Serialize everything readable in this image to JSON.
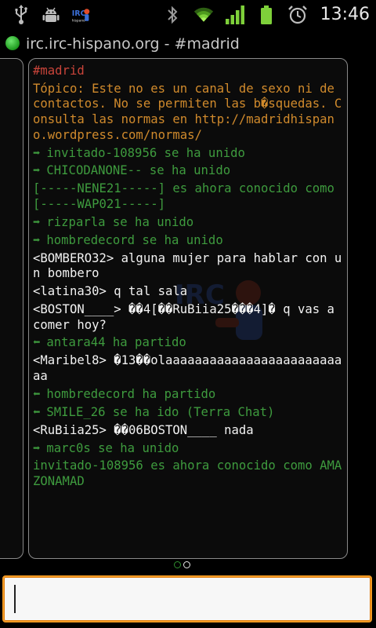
{
  "status_bar": {
    "time": "13:46",
    "icons": [
      "usb-icon",
      "android-debug-icon",
      "irc-hispano-app-icon",
      "bluetooth-icon",
      "wifi-icon",
      "signal-icon",
      "battery-icon",
      "alarm-icon"
    ],
    "app_icon_text": "IRC"
  },
  "title_bar": {
    "title": "irc.irc-hispano.org - #madrid",
    "status_color": "#2fb62f"
  },
  "watermark_text": "IRC",
  "colors": {
    "channel": "#c9443a",
    "topic": "#d08a2c",
    "event": "#3e9b3e",
    "message": "#f2f2f2",
    "input_border": "#f29a24"
  },
  "chat": {
    "messages": [
      {
        "type": "channel",
        "text": "#madrid"
      },
      {
        "type": "topic",
        "text": "Tópico: Este no es un canal de sexo ni de contactos. No se permiten las b�squedas. Consulta las normas en http://madridhispano.wordpress.com/normas/"
      },
      {
        "type": "join",
        "arrow": "➡",
        "text": "invitado-108956 se ha unido"
      },
      {
        "type": "join",
        "arrow": "➡",
        "text": "CHICODANONE-- se ha unido"
      },
      {
        "type": "event",
        "text": "[-----NENE21-----] es ahora conocido como [-----WAP021-----]"
      },
      {
        "type": "join",
        "arrow": "➡",
        "text": "rizparla se ha unido"
      },
      {
        "type": "join",
        "arrow": "➡",
        "text": "hombredecord se ha unido"
      },
      {
        "type": "message",
        "text": "<BOMBERO32> alguna mujer para hablar con un bombero"
      },
      {
        "type": "message",
        "text": "<latina30> q tal sala"
      },
      {
        "type": "message",
        "text": "<BOSTON____> ��4[��RuBiia25���4]� q vas a comer hoy?"
      },
      {
        "type": "part",
        "arrow": "⬅",
        "text": "antara44 ha partido"
      },
      {
        "type": "message",
        "text": "<Maribel8> �13��olaaaaaaaaaaaaaaaaaaaaaaaaaa"
      },
      {
        "type": "part",
        "arrow": "⬅",
        "text": "hombredecord ha partido"
      },
      {
        "type": "part",
        "arrow": "⬅",
        "text": "SMILE_26 se ha ido (Terra Chat)"
      },
      {
        "type": "message",
        "text": "<RuBiia25> ��06BOSTON____ nada"
      },
      {
        "type": "join",
        "arrow": "➡",
        "text": "marc0s se ha unido"
      },
      {
        "type": "event",
        "text": "invitado-108956 es ahora conocido como AMAZONAMAD"
      }
    ]
  },
  "pager": {
    "count": 2,
    "active_index": 1
  },
  "input": {
    "value": "",
    "placeholder": ""
  }
}
